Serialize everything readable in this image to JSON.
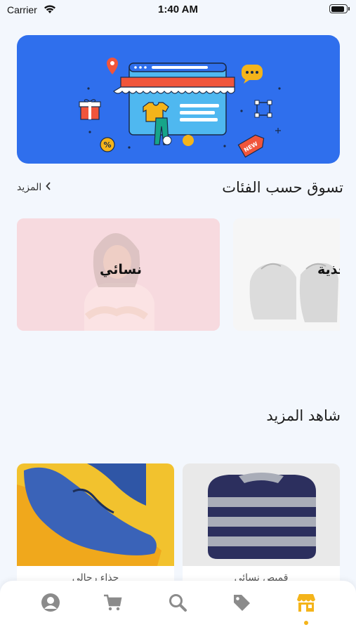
{
  "status_bar": {
    "carrier": "Carrier",
    "time": "1:40 AM"
  },
  "colors": {
    "accent": "#f4b41a",
    "banner": "#2f6fed",
    "background": "#f3f7fd"
  },
  "banner": {
    "badge_sale": "%",
    "badge_new": "NEW"
  },
  "categories_section": {
    "title": "تسوق حسب الفئات",
    "more_label": "المزيد",
    "items": [
      {
        "label": "نسائي"
      },
      {
        "label": "أحذية"
      }
    ]
  },
  "see_more_section": {
    "title": "شاهد المزيد",
    "products": [
      {
        "title": "قميص نسائي"
      },
      {
        "title": "حذاء رجالي"
      }
    ]
  },
  "tabbar": {
    "tabs": [
      {
        "icon": "profile-icon"
      },
      {
        "icon": "cart-icon"
      },
      {
        "icon": "search-icon"
      },
      {
        "icon": "tag-icon"
      },
      {
        "icon": "store-icon",
        "active": true
      }
    ]
  }
}
